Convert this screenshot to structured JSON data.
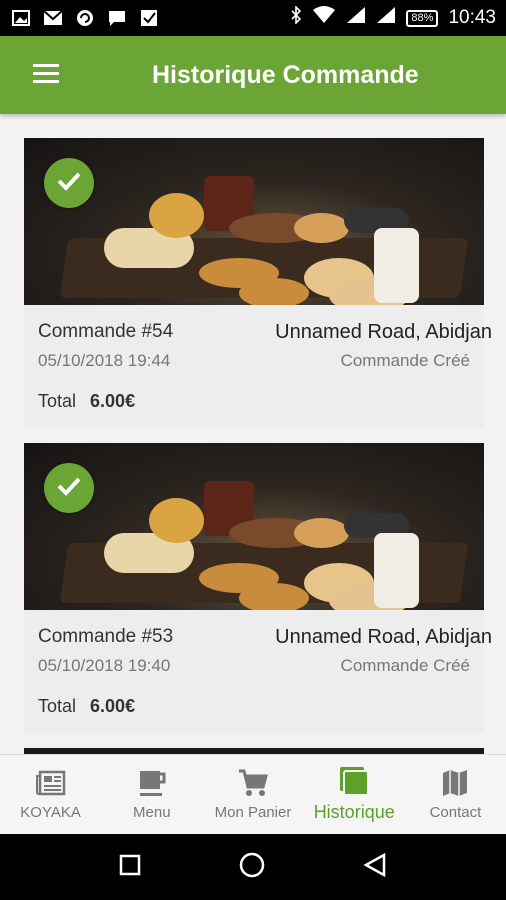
{
  "statusbar": {
    "time": "10:43",
    "battery": "88%"
  },
  "appbar": {
    "title": "Historique Commande",
    "menu_icon": "hamburger-icon"
  },
  "orders": [
    {
      "number": "Commande #54",
      "date": "05/10/2018 19:44",
      "address": "Unnamed Road, Abidjan",
      "status": "Commande Créé",
      "total_label": "Total",
      "total_value": "6.00€"
    },
    {
      "number": "Commande #53",
      "date": "05/10/2018 19:40",
      "address": "Unnamed Road, Abidjan",
      "status": "Commande Créé",
      "total_label": "Total",
      "total_value": "6.00€"
    }
  ],
  "bottomnav": [
    {
      "label": "KOYAKA",
      "icon": "newspaper-icon"
    },
    {
      "label": "Menu",
      "icon": "cup-icon"
    },
    {
      "label": "Mon Panier",
      "icon": "cart-icon"
    },
    {
      "label": "Historique",
      "icon": "history-icon",
      "active": true
    },
    {
      "label": "Contact",
      "icon": "map-icon"
    }
  ],
  "colors": {
    "primary": "#6aa535",
    "active_nav": "#5fa028"
  }
}
